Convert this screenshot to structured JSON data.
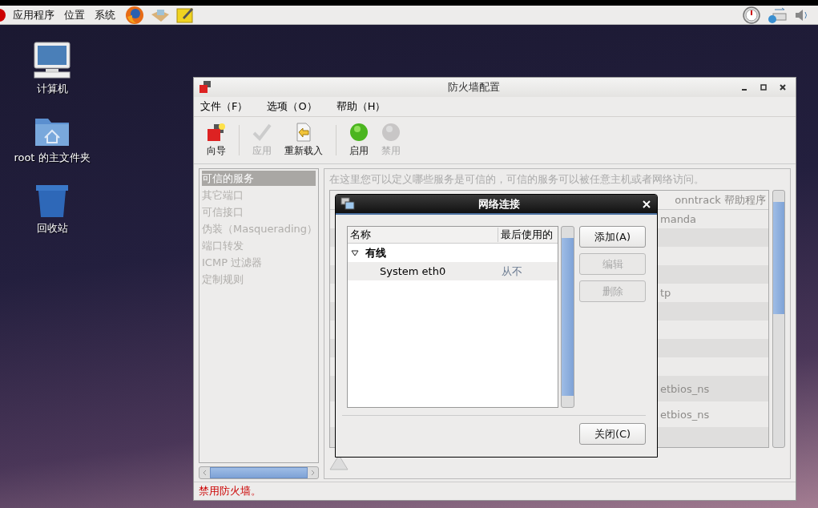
{
  "top_panel": {
    "menus": [
      "应用程序",
      "位置",
      "系统"
    ]
  },
  "desktop_icons": [
    {
      "label": "计算机",
      "kind": "computer"
    },
    {
      "label": "root 的主文件夹",
      "kind": "home"
    },
    {
      "label": "回收站",
      "kind": "trash"
    }
  ],
  "firewall_window": {
    "title": "防火墙配置",
    "menu": [
      "文件（F）",
      "选项（O）",
      "帮助（H）"
    ],
    "toolbar": [
      {
        "label": "向导",
        "kind": "wizard",
        "disabled": false
      },
      {
        "label": "应用",
        "kind": "apply",
        "disabled": true
      },
      {
        "label": "重新载入",
        "kind": "reload",
        "disabled": false
      },
      {
        "label": "启用",
        "kind": "enable",
        "disabled": false
      },
      {
        "label": "禁用",
        "kind": "disable",
        "disabled": true
      }
    ],
    "sidebar": [
      {
        "label": "可信的服务",
        "selected": true
      },
      {
        "label": "其它端口",
        "selected": false
      },
      {
        "label": "可信接口",
        "selected": false
      },
      {
        "label": "伪装（Masquerading）",
        "selected": false
      },
      {
        "label": "端口转发",
        "selected": false
      },
      {
        "label": "ICMP 过滤器",
        "selected": false
      },
      {
        "label": "定制规则",
        "selected": false
      }
    ],
    "description": "在这里您可以定义哪些服务是可信的，可信的服务可以被任意主机或者网络访问。",
    "services_table": {
      "column_2": "onntrack 帮助程序",
      "rows": [
        "manda",
        "",
        "",
        "",
        "tp",
        "",
        "",
        "",
        "",
        "etbios_ns",
        "etbios_ns",
        ""
      ]
    },
    "status": "禁用防火墙。"
  },
  "dialog": {
    "title": "网络连接",
    "columns": [
      "名称",
      "最后使用的"
    ],
    "groups": [
      {
        "name": "有线",
        "expanded": true,
        "children": [
          {
            "name": "System eth0",
            "last_used": "从不"
          }
        ]
      }
    ],
    "buttons": [
      {
        "label": "添加(A)",
        "disabled": false
      },
      {
        "label": "编辑",
        "disabled": true
      },
      {
        "label": "删除",
        "disabled": true
      }
    ],
    "close_button": "关闭(C)"
  }
}
